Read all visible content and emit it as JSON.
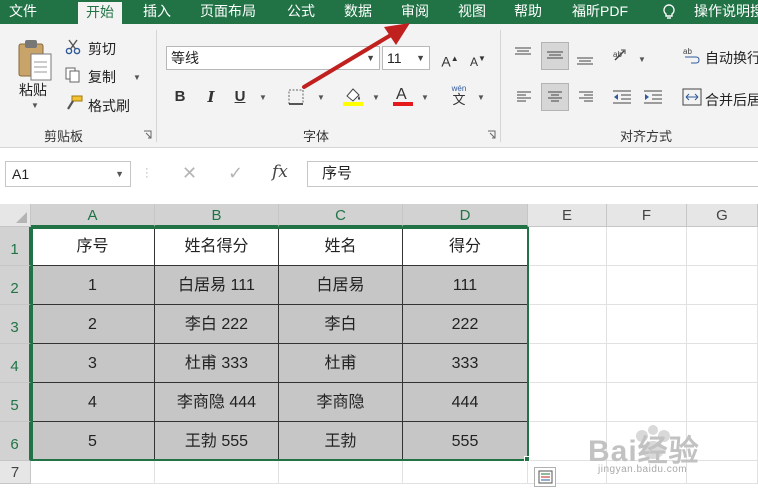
{
  "menu": {
    "tabs": [
      "文件",
      "开始",
      "插入",
      "页面布局",
      "公式",
      "数据",
      "审阅",
      "视图",
      "帮助",
      "福昕PDF"
    ],
    "active_tab": "开始",
    "tell_me": "操作说明搜"
  },
  "ribbon": {
    "clipboard": {
      "paste": "粘贴",
      "cut": "剪切",
      "copy": "复制",
      "format_painter": "格式刷",
      "group_label": "剪贴板"
    },
    "font": {
      "font_name": "等线",
      "font_size": "11",
      "bold": "B",
      "italic": "I",
      "underline": "U",
      "phonetic": "wén",
      "phonetic_char": "文",
      "group_label": "字体"
    },
    "alignment": {
      "wrap_text": "自动换行",
      "merge_center": "合并后居",
      "group_label": "对齐方式"
    }
  },
  "formula_bar": {
    "name_box": "A1",
    "fx": "fx",
    "content": "序号"
  },
  "sheet": {
    "columns": [
      "A",
      "B",
      "C",
      "D",
      "E",
      "F",
      "G"
    ],
    "rows": [
      "1",
      "2",
      "3",
      "4",
      "5",
      "6",
      "7"
    ],
    "table": [
      [
        "序号",
        "姓名得分",
        "姓名",
        "得分"
      ],
      [
        "1",
        "白居易 111",
        "白居易",
        "111"
      ],
      [
        "2",
        "李白 222",
        "李白",
        "222"
      ],
      [
        "3",
        "杜甫 333",
        "杜甫",
        "333"
      ],
      [
        "4",
        "李商隐 444",
        "李商隐",
        "444"
      ],
      [
        "5",
        "王勃 555",
        "王勃",
        "555"
      ]
    ]
  },
  "watermark": {
    "logo_text": "Bai经验",
    "url_text": "jingyan.baidu.com"
  },
  "colors": {
    "excel_green": "#217346",
    "selection_fill": "#c6c6c6",
    "arrow": "#c0201e"
  }
}
